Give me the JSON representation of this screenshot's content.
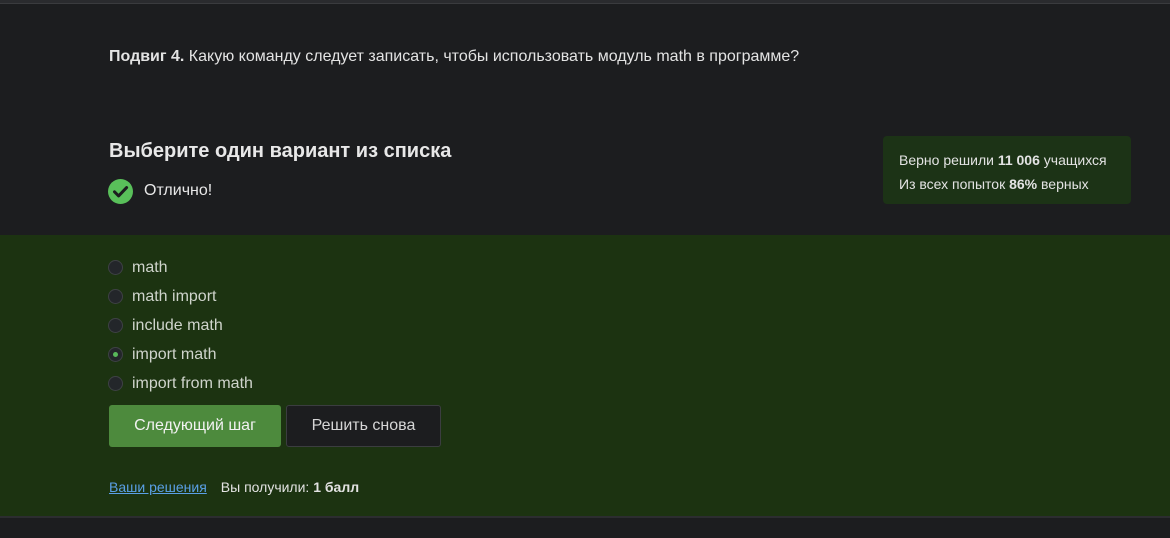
{
  "question": {
    "prefix": "Подвиг 4.",
    "text": " Какую команду следует записать, чтобы использовать модуль math в программе?"
  },
  "section_title": "Выберите один вариант из списка",
  "status": {
    "icon": "check-circle-icon",
    "text": "Отлично!",
    "color": "#59c05a"
  },
  "stats": {
    "line1_prefix": "Верно решили ",
    "line1_count": "11 006",
    "line1_suffix": " учащихся",
    "line2_prefix": "Из всех попыток ",
    "line2_percent": "86%",
    "line2_suffix": " верных"
  },
  "options": [
    {
      "label": "math",
      "selected": false
    },
    {
      "label": "math import",
      "selected": false
    },
    {
      "label": "include math",
      "selected": false
    },
    {
      "label": "import math",
      "selected": true
    },
    {
      "label": "import from math",
      "selected": false
    }
  ],
  "buttons": {
    "next": "Следующий шаг",
    "retry": "Решить снова"
  },
  "footer": {
    "solutions_link": "Ваши решения",
    "score_prefix": "Вы получили: ",
    "score_value": "1 балл"
  },
  "colors": {
    "accent_green": "#4d8a3d",
    "panel_green": "#1c3311",
    "link_blue": "#5aa0e6"
  }
}
